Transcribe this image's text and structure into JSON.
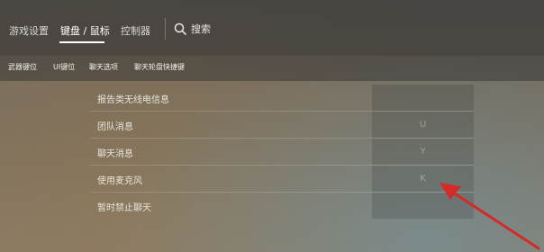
{
  "top_nav": {
    "tabs": [
      {
        "label": "游戏设置",
        "active": false
      },
      {
        "label": "键盘 / 鼠标",
        "active": true
      },
      {
        "label": "控制器",
        "active": false
      }
    ],
    "search_label": "搜索"
  },
  "sub_nav": {
    "tabs": [
      {
        "label": "武器键位"
      },
      {
        "label": "UI键位"
      },
      {
        "label": "聊天选项"
      },
      {
        "label": "聊天轮盘快捷键"
      }
    ]
  },
  "binding_rows": [
    {
      "label": "报告类无线电信息",
      "key": ""
    },
    {
      "label": "团队消息",
      "key": "U"
    },
    {
      "label": "聊天消息",
      "key": "Y"
    },
    {
      "label": "使用麦克风",
      "key": "K"
    },
    {
      "label": "暂时禁止聊天",
      "key": ""
    }
  ],
  "colors": {
    "annotation_arrow": "#d42a2a",
    "active_underline": "#ffffff"
  }
}
